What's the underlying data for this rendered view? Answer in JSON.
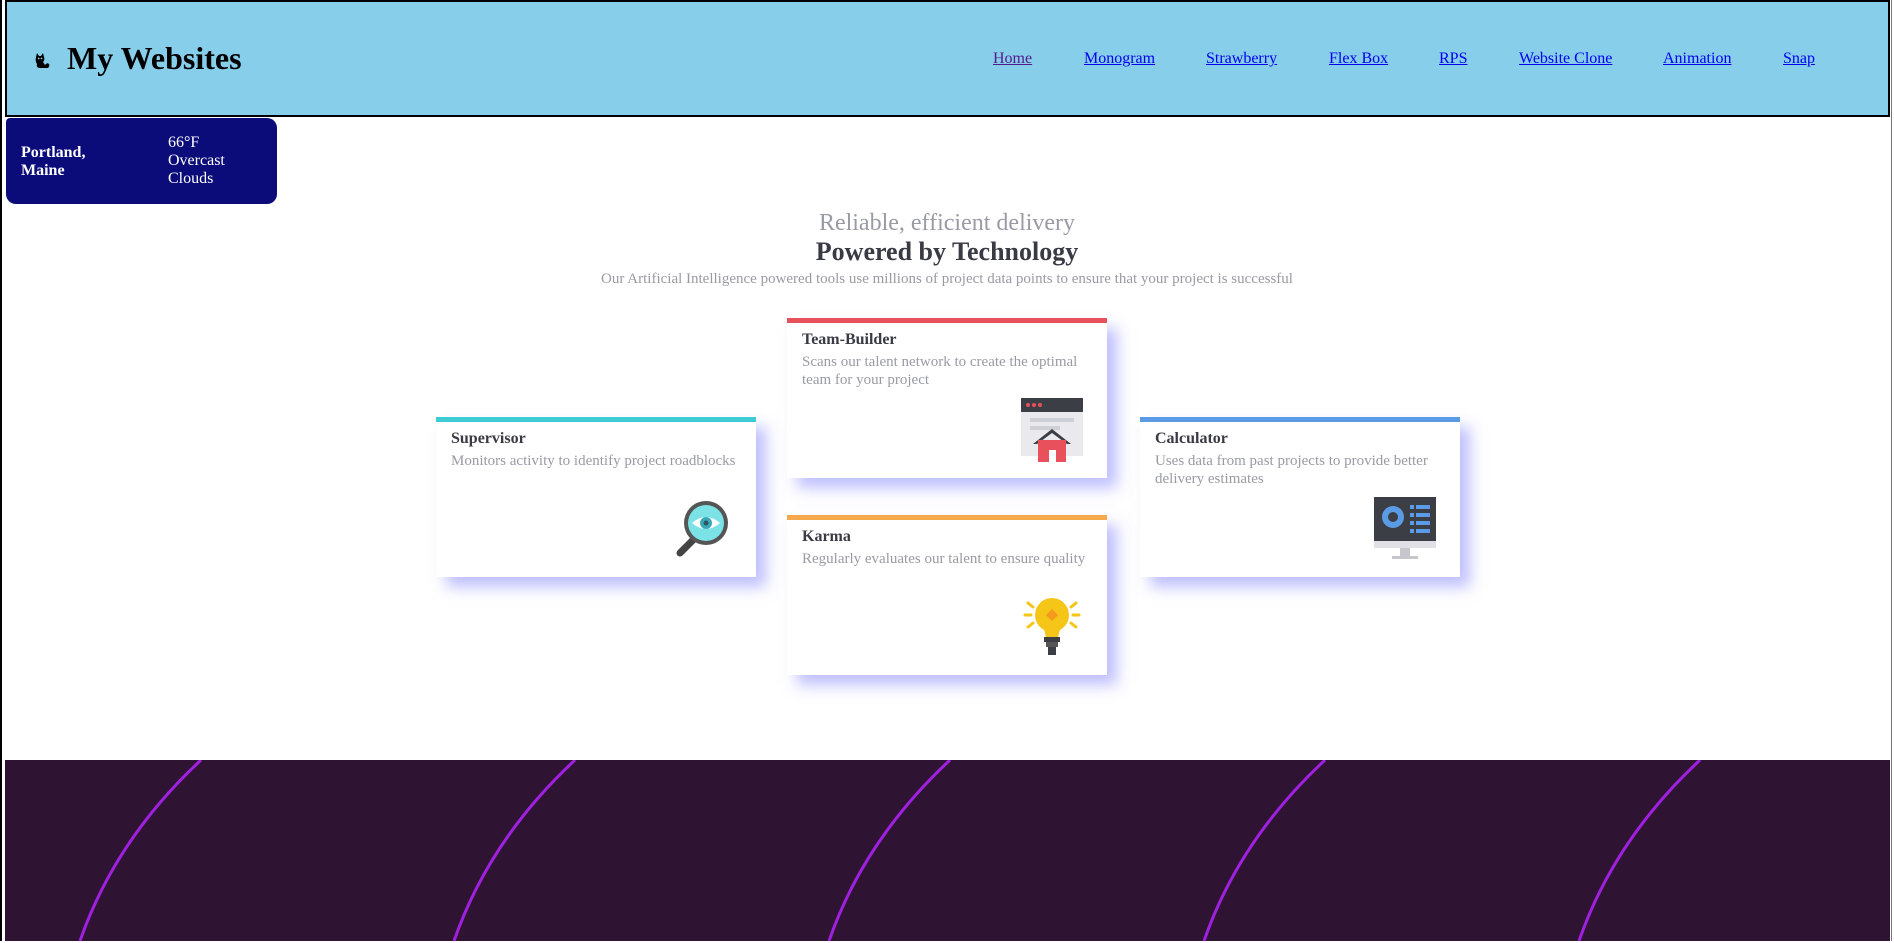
{
  "header": {
    "logo_icon": "cat-icon",
    "title": "My Websites",
    "nav": [
      {
        "label": "Home",
        "visited": true
      },
      {
        "label": "Monogram",
        "visited": false
      },
      {
        "label": "Strawberry",
        "visited": false
      },
      {
        "label": "Flex Box",
        "visited": false
      },
      {
        "label": "RPS",
        "visited": false
      },
      {
        "label": "Website Clone",
        "visited": false
      },
      {
        "label": "Animation",
        "visited": false
      },
      {
        "label": "Snap",
        "visited": false
      }
    ]
  },
  "weather": {
    "city": "Portland, Maine",
    "temperature": "66°F",
    "condition_line1": "Overcast",
    "condition_line2": "Clouds"
  },
  "intro": {
    "tagline": "Reliable, efficient delivery",
    "headline": "Powered by Technology",
    "subtext": "Our Artificial Intelligence powered tools use millions of project data points to ensure that your project is successful"
  },
  "cards": [
    {
      "title": "Supervisor",
      "description": "Monitors activity to identify project roadblocks",
      "accent": "#3dccd6",
      "icon": "magnifier-eye-icon"
    },
    {
      "title": "Team-Builder",
      "description": "Scans our talent network to create the optimal team for your project",
      "accent": "#e8505b",
      "icon": "browser-house-icon"
    },
    {
      "title": "Karma",
      "description": "Regularly evaluates our talent to ensure quality",
      "accent": "#f5a94c",
      "icon": "lightbulb-icon"
    },
    {
      "title": "Calculator",
      "description": "Uses data from past projects to provide better delivery estimates",
      "accent": "#5b9be6",
      "icon": "monitor-dashboard-icon"
    }
  ],
  "colors": {
    "header_bg": "#87ceeb",
    "weather_bg": "#0b0b7a",
    "footer_bg": "#2f1333",
    "footer_curve": "#a020e0"
  }
}
